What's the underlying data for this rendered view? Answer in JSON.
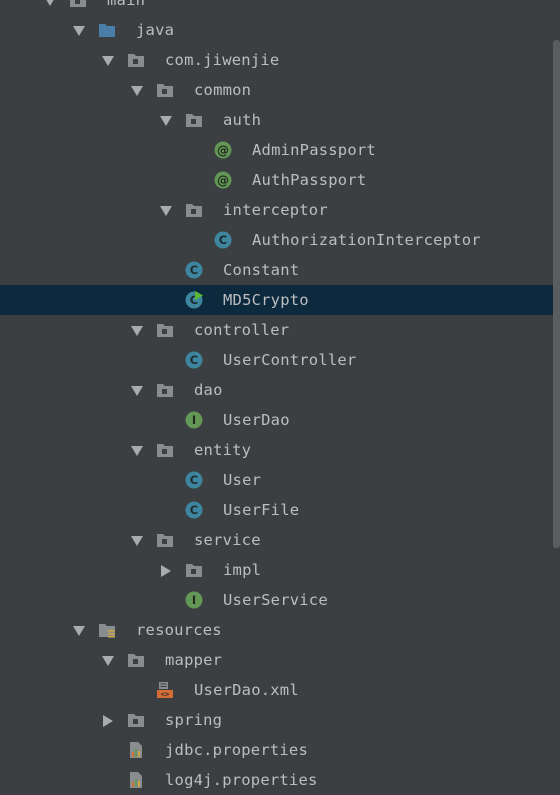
{
  "project_tree": {
    "rows": [
      {
        "label": "main",
        "indent": 1,
        "arrow": "down",
        "icon": "folder-plain-icon"
      },
      {
        "label": "java",
        "indent": 2,
        "arrow": "down",
        "icon": "folder-source-icon"
      },
      {
        "label": "com.jiwenjie",
        "indent": 3,
        "arrow": "down",
        "icon": "package-icon"
      },
      {
        "label": "common",
        "indent": 4,
        "arrow": "down",
        "icon": "package-icon"
      },
      {
        "label": "auth",
        "indent": 5,
        "arrow": "down",
        "icon": "package-icon"
      },
      {
        "label": "AdminPassport",
        "indent": 6,
        "arrow": "none",
        "icon": "annotation-icon"
      },
      {
        "label": "AuthPassport",
        "indent": 6,
        "arrow": "none",
        "icon": "annotation-icon"
      },
      {
        "label": "interceptor",
        "indent": 5,
        "arrow": "down",
        "icon": "package-icon"
      },
      {
        "label": "AuthorizationInterceptor",
        "indent": 6,
        "arrow": "none",
        "icon": "class-icon"
      },
      {
        "label": "Constant",
        "indent": 5,
        "arrow": "none",
        "icon": "class-icon"
      },
      {
        "label": "MD5Crypto",
        "indent": 5,
        "arrow": "none",
        "icon": "class-runnable-icon",
        "selected": true
      },
      {
        "label": "controller",
        "indent": 4,
        "arrow": "down",
        "icon": "package-icon"
      },
      {
        "label": "UserController",
        "indent": 5,
        "arrow": "none",
        "icon": "class-icon"
      },
      {
        "label": "dao",
        "indent": 4,
        "arrow": "down",
        "icon": "package-icon"
      },
      {
        "label": "UserDao",
        "indent": 5,
        "arrow": "none",
        "icon": "interface-icon"
      },
      {
        "label": "entity",
        "indent": 4,
        "arrow": "down",
        "icon": "package-icon"
      },
      {
        "label": "User",
        "indent": 5,
        "arrow": "none",
        "icon": "class-icon"
      },
      {
        "label": "UserFile",
        "indent": 5,
        "arrow": "none",
        "icon": "class-icon"
      },
      {
        "label": "service",
        "indent": 4,
        "arrow": "down",
        "icon": "package-icon"
      },
      {
        "label": "impl",
        "indent": 5,
        "arrow": "right",
        "icon": "package-icon"
      },
      {
        "label": "UserService",
        "indent": 5,
        "arrow": "none",
        "icon": "interface-icon"
      },
      {
        "label": "resources",
        "indent": 2,
        "arrow": "down",
        "icon": "folder-resources-icon"
      },
      {
        "label": "mapper",
        "indent": 3,
        "arrow": "down",
        "icon": "package-icon"
      },
      {
        "label": "UserDao.xml",
        "indent": 4,
        "arrow": "none",
        "icon": "xml-file-icon"
      },
      {
        "label": "spring",
        "indent": 3,
        "arrow": "right",
        "icon": "package-icon"
      },
      {
        "label": "jdbc.properties",
        "indent": 3,
        "arrow": "none",
        "icon": "properties-file-icon"
      },
      {
        "label": "log4j.properties",
        "indent": 3,
        "arrow": "none",
        "icon": "properties-file-icon"
      }
    ]
  },
  "colors": {
    "background": "#3c3f41",
    "selected_row": "#0d293e",
    "text": "#bbbdbf",
    "arrow": "#a9abad",
    "class_icon": "#3e86a0",
    "interface_icon": "#629755",
    "annotation_icon": "#629755",
    "folder": "#8a8d8f",
    "source_folder": "#4a7ea8",
    "run_marker": "#5fb832",
    "xml_icon": "#d36d36"
  }
}
